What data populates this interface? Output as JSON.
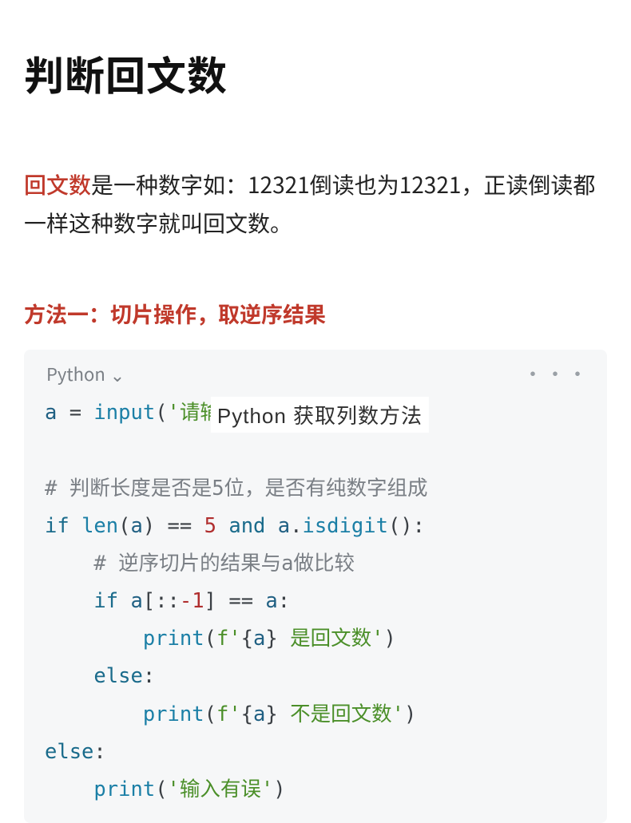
{
  "title": "判断回文数",
  "desc": {
    "term": "回文数",
    "rest": "是一种数字如：12321倒读也为12321，正读倒读都一样这种数字就叫回文数。"
  },
  "method_heading": "方法一：切片操作，取逆序结果",
  "code_header": {
    "language": "Python",
    "chevron": "⌄",
    "more": "•••"
  },
  "overlay_text": "Python 获取列数方法",
  "code": {
    "l1": {
      "a": "a",
      "op": " = ",
      "fn": "input",
      "p1": "(",
      "s": "'请输入一个五位数：'",
      "p2": ")"
    },
    "blank1": "",
    "l2": {
      "cmt": "# 判断长度是否是5位，是否有纯数字组成"
    },
    "l3": {
      "kw1": "if ",
      "fn": "len",
      "p1": "(",
      "a": "a",
      "p2": ")",
      "op1": " == ",
      "num": "5",
      "op2": " and ",
      "a2": "a",
      "dot": ".",
      "fn2": "isdigit",
      "p3": "()",
      "colon": ":"
    },
    "l4": {
      "cmt": "# 逆序切片的结果与a做比较"
    },
    "l5": {
      "kw": "if ",
      "a": "a",
      "p1": "[::",
      "neg": "-1",
      "p2": "]",
      "op": " == ",
      "a2": "a",
      "colon": ":"
    },
    "l6": {
      "fn": "print",
      "p1": "(",
      "f": "f",
      "q1": "'",
      "b1": "{",
      "a": "a",
      "b2": "}",
      "txt": " 是回文数",
      "q2": "'",
      "p2": ")"
    },
    "l7": {
      "kw": "else",
      "colon": ":"
    },
    "l8": {
      "fn": "print",
      "p1": "(",
      "f": "f",
      "q1": "'",
      "b1": "{",
      "a": "a",
      "b2": "}",
      "txt": " 不是回文数",
      "q2": "'",
      "p2": ")"
    },
    "l9": {
      "kw": "else",
      "colon": ":"
    },
    "l10": {
      "fn": "print",
      "p1": "(",
      "s": "'输入有误'",
      "p2": ")"
    }
  }
}
